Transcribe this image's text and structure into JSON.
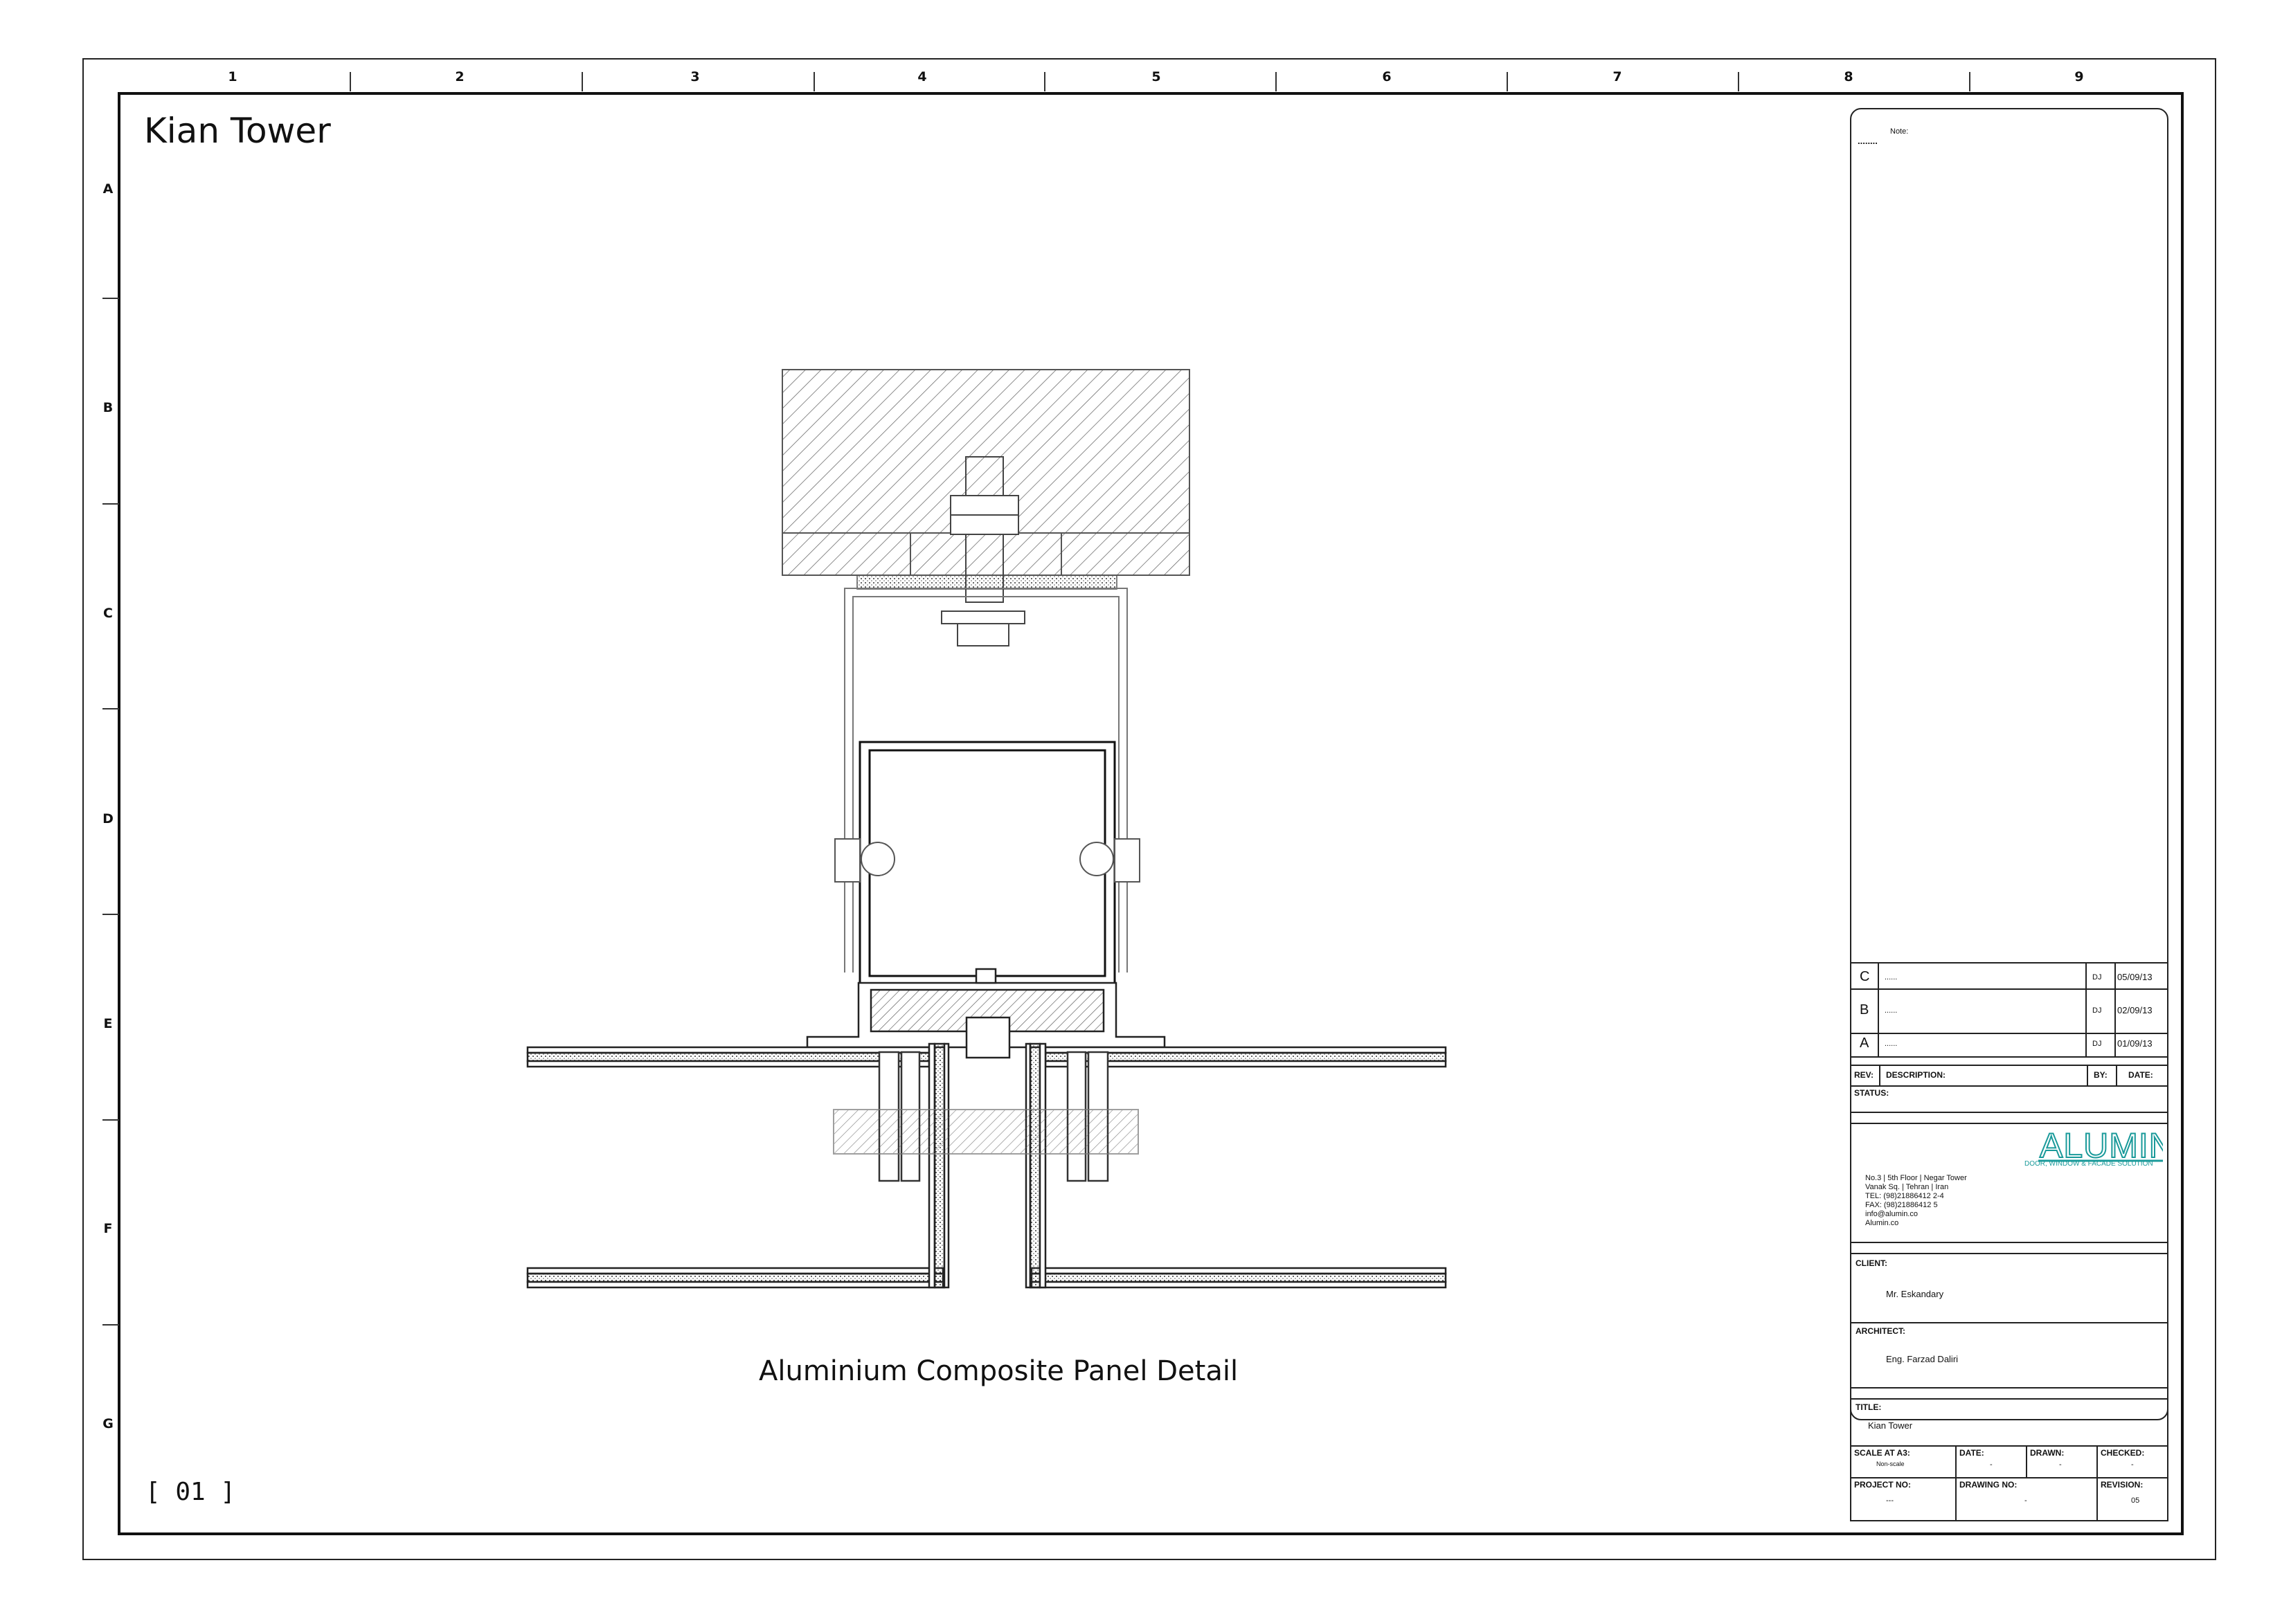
{
  "sheet": {
    "columns": [
      "1",
      "2",
      "3",
      "4",
      "5",
      "6",
      "7",
      "8",
      "9"
    ],
    "rows": [
      "A",
      "B",
      "C",
      "D",
      "E",
      "F",
      "G"
    ]
  },
  "drawing": {
    "project_title": "Kian Tower",
    "detail_title": "Aluminium Composite Panel Detail",
    "detail_number": "[ 01 ]"
  },
  "title_block": {
    "note_label": "Note:",
    "note_text": "........",
    "revisions": [
      {
        "rev": "C",
        "desc": "......",
        "by": "DJ",
        "date": "05/09/13"
      },
      {
        "rev": "B",
        "desc": "......",
        "by": "DJ",
        "date": "02/09/13"
      },
      {
        "rev": "A",
        "desc": "......",
        "by": "DJ",
        "date": "01/09/13"
      }
    ],
    "rev_headers": {
      "rev": "REV:",
      "desc": "DESCRIPTION:",
      "by": "BY:",
      "date": "DATE:"
    },
    "status_label": "STATUS:",
    "company": {
      "logo": "ALUMIN",
      "tagline": "DOOR, WINDOW & FACADE SOLUTION",
      "address": [
        "No.3 | 5th Floor | Negar Tower",
        "Vanak Sq. | Tehran | Iran",
        "TEL: (98)21886412 2-4",
        "FAX: (98)21886412 5",
        "info@alumin.co",
        "Alumin.co"
      ],
      "brand_color": "#1a9a9a"
    },
    "client_label": "CLIENT:",
    "client": "Mr. Eskandary",
    "architect_label": "ARCHITECT:",
    "architect": "Eng. Farzad Daliri",
    "title_label": "TITLE:",
    "title": "Kian Tower",
    "scale_label": "SCALE AT A3:",
    "scale": "Non-scale",
    "date_label": "DATE:",
    "date": "-",
    "drawn_label": "DRAWN:",
    "drawn": "-",
    "checked_label": "CHECKED:",
    "checked": "-",
    "project_no_label": "PROJECT NO:",
    "project_no": "---",
    "drawing_no_label": "DRAWING NO:",
    "drawing_no": "-",
    "revision_label": "REVISION:",
    "revision": "05"
  }
}
